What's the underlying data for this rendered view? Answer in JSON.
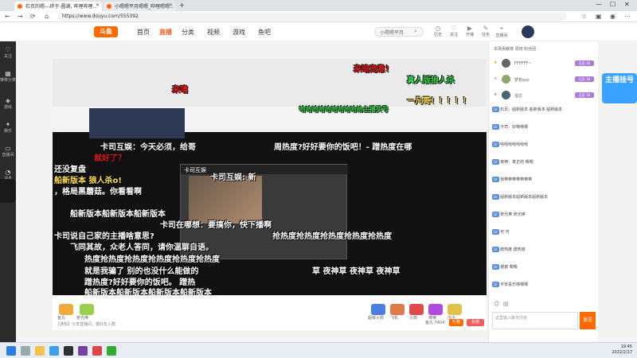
{
  "browser": {
    "tabs": [
      {
        "label": "石页的嗯---终于-圆满, 哔哩哔哩..."
      },
      {
        "label": "小嗯嗯平月嗯嗯_哔哩嗯嗯..."
      }
    ],
    "new_tab": "+",
    "url": "https://www.douyu.com/555392"
  },
  "header": {
    "logo": "斗鱼",
    "nav": [
      "首页",
      "直播",
      "分类",
      "视频",
      "游戏",
      "鱼吧"
    ],
    "search_placeholder": "小嗯嗯平月",
    "icons": [
      "历史",
      "关注",
      "开播",
      "任务",
      "直播间"
    ]
  },
  "leftbar": [
    "关注",
    "推荐分类",
    "游戏",
    "娱乐",
    "直播间",
    "消息"
  ],
  "danmaku": [
    {
      "t": "来暗宠意！",
      "c": "r"
    },
    {
      "t": "真人版狼人杀",
      "c": "g"
    },
    {
      "t": "来嘻",
      "c": "r"
    },
    {
      "t": "哈哈哈哈哈哈哈哈哈给主播买号",
      "c": "g"
    },
    {
      "t": "一凡哥！！！！！",
      "c": "y"
    },
    {
      "t": "卡司互娱：今天必须，给哥",
      "c": ""
    },
    {
      "t": "就好了？",
      "c": "r"
    },
    {
      "t": "周热度?好好要你的饭吧！-  蹭热度在哪",
      "c": ""
    },
    {
      "t": "还没复盘",
      "c": ""
    },
    {
      "t": "船新版本 狼人杀o!",
      "c": "y"
    },
    {
      "t": "卡司互娱: 新",
      "c": ""
    },
    {
      "t": "，格局黑蘑菇。你看看啊",
      "c": ""
    },
    {
      "t": "船新版本船新版本船新版本",
      "c": ""
    },
    {
      "t": "卡司在哪想：要搞你，快下播啊",
      "c": ""
    },
    {
      "t": "卡司说自己家的主播啥意思?",
      "c": ""
    },
    {
      "t": "抢热度抢热度抢热度抢热度抢热度",
      "c": ""
    },
    {
      "t": "飞同其故，众老人答同，请你温聊自语。",
      "c": ""
    },
    {
      "t": "热度抢热度抢热度抢热度抢热度抢热度",
      "c": ""
    },
    {
      "t": "就是我骗了 别的也没什么能做的",
      "c": ""
    },
    {
      "t": "草 夜神草 夜神草 夜神草",
      "c": ""
    },
    {
      "t": "蹭热度?好好要你的饭吧。  蹭热",
      "c": ""
    },
    {
      "t": "船新版本船新版本船新版本船新版本",
      "c": ""
    }
  ],
  "pip_title": "卡司互娱",
  "player_bar": {
    "gifts": [
      "鱼丸",
      "荧光棒",
      "超级火箭",
      "飞机",
      "火箭",
      "棒棒",
      "办卡"
    ],
    "fish": "鱼丸 7404",
    "gift_btn": "礼物",
    "charge_btn": "充值",
    "room_tip": "【通知】分享直播间，邀好友入群"
  },
  "chat": {
    "header": "本场贡献榜  周榜  粉丝团",
    "ranks": [
      {
        "name": "FFFFFF~",
        "badge": "石页 20"
      },
      {
        "name": "梦想xxx",
        "badge": "石页 18"
      },
      {
        "name": "溜达",
        "badge": "石页 16"
      }
    ],
    "messages": [
      "石页：船新版本 船新版本 船新版本",
      "卡司：好嗯嗯嗯",
      "哈哈哈哈哈哈哈",
      "夜神：真正的 嗯嗯",
      "我带带带带带带带",
      "船新版本船新版本船新版本",
      "荧光棒 荧光棒",
      "可 可",
      "蹭热度 蹭热度",
      "谢谢 嗯嗯",
      "平安喜乐嗯嗯嗯"
    ],
    "input_placeholder": "这里输入聊天内容",
    "send": "发送"
  },
  "promo": "主播挂号",
  "clock": {
    "time": "19:45",
    "date": "2022/2/17"
  }
}
